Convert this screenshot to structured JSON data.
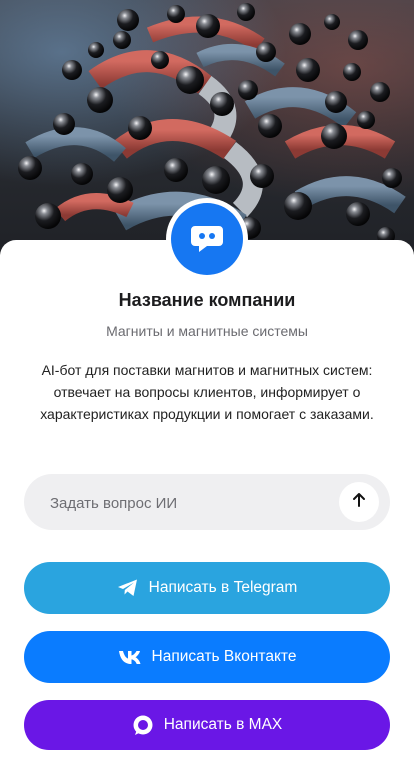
{
  "company": {
    "name": "Название компании",
    "tagline": "Магниты и магнитные системы",
    "description": "AI-бот для поставки магнитов и магнитных систем: отвечает на вопросы клиентов, информирует о характеристиках продукции и помогает с заказами."
  },
  "ask": {
    "placeholder": "Задать вопрос ИИ",
    "value": ""
  },
  "buttons": {
    "telegram": "Написать в Telegram",
    "vkontakte": "Написать Вконтакте",
    "max": "Написать в MAX"
  },
  "colors": {
    "avatar": "#1677f2",
    "telegram": "#2aa4df",
    "vkontakte": "#0a7cff",
    "max": "#6a17e6"
  },
  "icons": {
    "avatar": "chat-bot-icon",
    "send": "arrow-up-icon",
    "telegram": "telegram-icon",
    "vkontakte": "vk-icon",
    "max": "max-icon"
  }
}
